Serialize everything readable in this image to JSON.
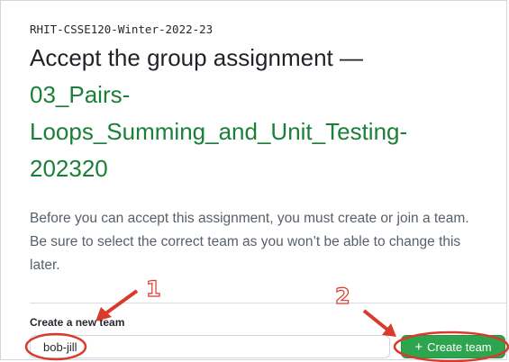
{
  "organization": "RHIT-CSSE120-Winter-2022-23",
  "heading": {
    "prefix": "Accept the group assignment —",
    "assignment_line1": "03_Pairs-",
    "assignment_line2": "Loops_Summing_and_Unit_Testing-",
    "assignment_line3": "202320"
  },
  "description": "Before you can accept this assignment, you must create or join a team. Be sure to select the correct team as you won’t be able to change this later.",
  "create_team": {
    "label": "Create a new team",
    "input_value": "bob-jill",
    "button_label": "Create team",
    "button_icon": "plus-icon"
  },
  "annotations": {
    "step1": "1",
    "step2": "2",
    "color": "#d93a2b"
  }
}
